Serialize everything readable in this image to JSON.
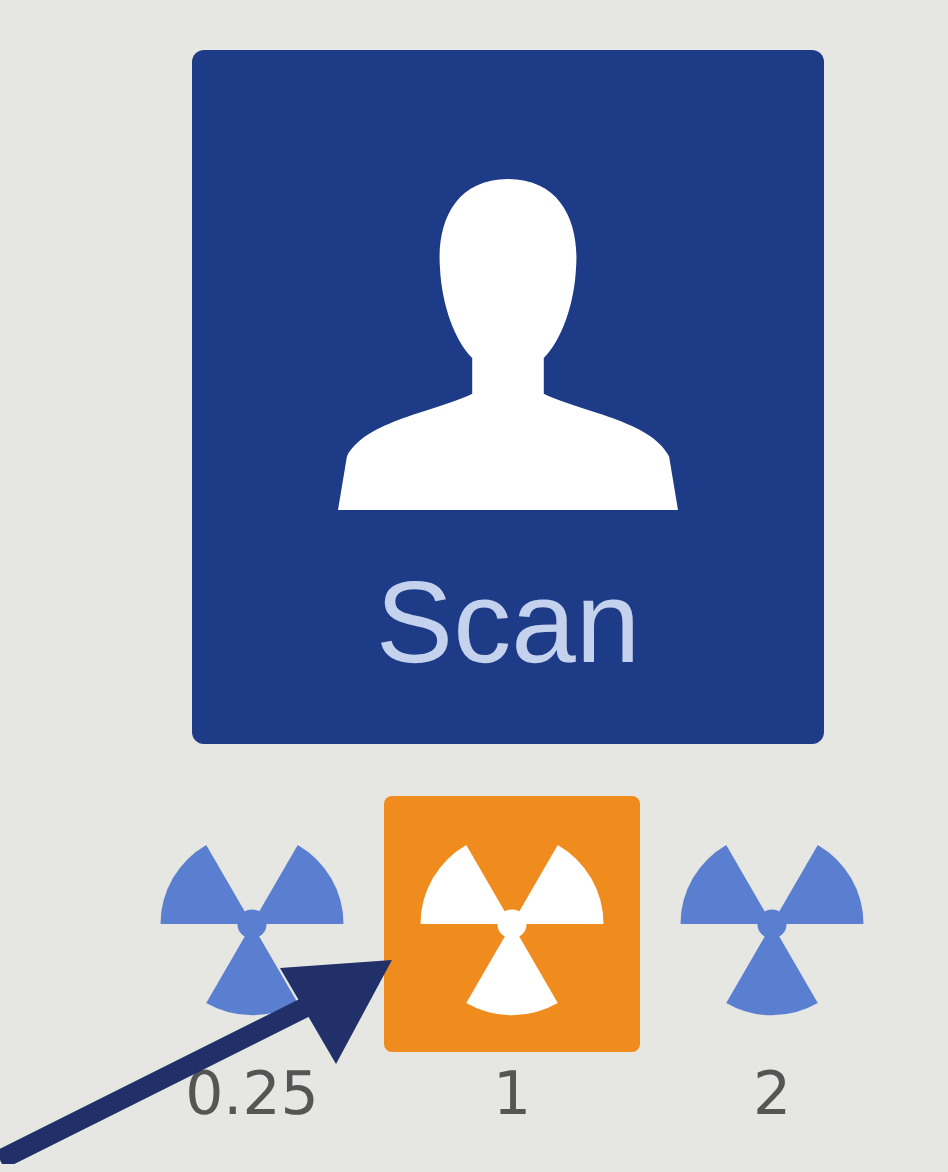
{
  "scan_button": {
    "label": "Scan"
  },
  "doses": [
    {
      "label": "0.25",
      "selected": false
    },
    {
      "label": "1",
      "selected": true
    },
    {
      "label": "2",
      "selected": false
    }
  ]
}
